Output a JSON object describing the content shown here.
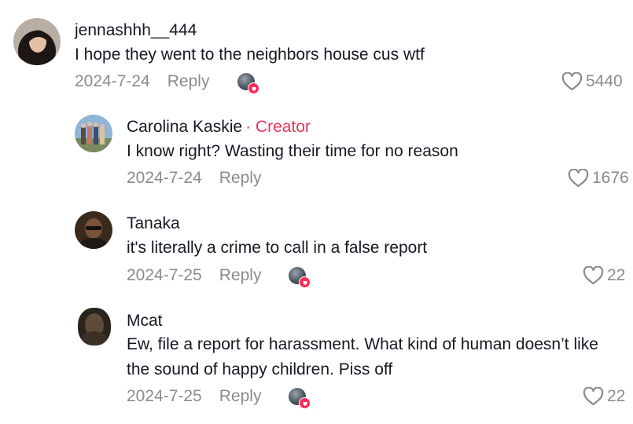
{
  "comments": [
    {
      "username": "jennashhh__444",
      "text": "I hope they went to the neighbors house cus wtf",
      "date": "2024-7-24",
      "reply_label": "Reply",
      "likes": "5440"
    },
    {
      "username": "Carolina Kaskie",
      "creator_label": "· Creator",
      "text": "I know right? Wasting their time for no reason",
      "date": "2024-7-24",
      "reply_label": "Reply",
      "likes": "1676"
    },
    {
      "username": "Tanaka",
      "text": "it's literally a crime to call in a false report",
      "date": "2024-7-25",
      "reply_label": "Reply",
      "likes": "22"
    },
    {
      "username": "Mcat",
      "text_line1": "Ew, file a report for harassment. What kind of human doesn’t like",
      "text_line2": "the sound of happy children. Piss off",
      "date": "2024-7-25",
      "reply_label": "Reply",
      "likes": "22"
    }
  ],
  "colors": {
    "creator_accent": "#e8375a",
    "meta_gray": "#8a8b91",
    "text": "#161823",
    "heart_badge": "#fe2c55"
  }
}
